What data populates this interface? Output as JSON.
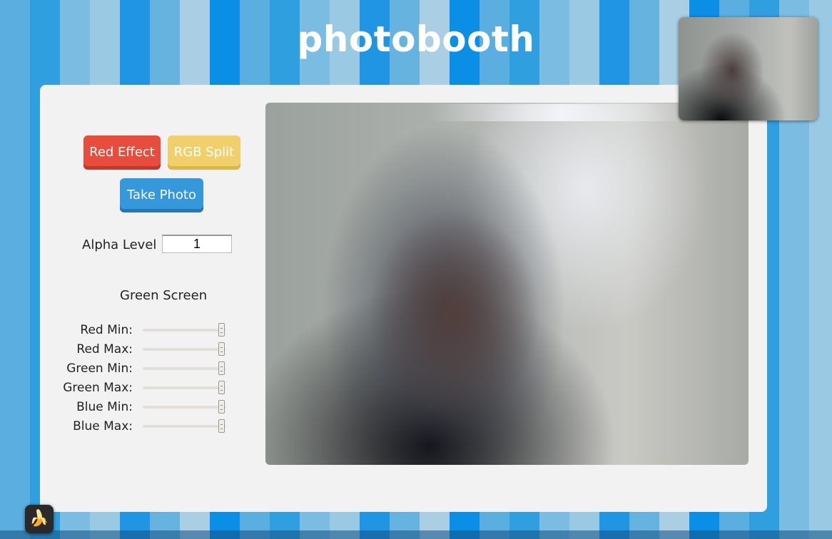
{
  "header": {
    "title": "photobooth"
  },
  "controls": {
    "red_effect_label": "Red Effect",
    "rgb_split_label": "RGB Split",
    "take_photo_label": "Take Photo",
    "alpha_label": "Alpha Level",
    "alpha_value": "1"
  },
  "green_screen": {
    "title": "Green Screen",
    "sliders": [
      {
        "label": "Red Min:",
        "value": 255
      },
      {
        "label": "Red Max:",
        "value": 255
      },
      {
        "label": "Green Min:",
        "value": 255
      },
      {
        "label": "Green Max:",
        "value": 255
      },
      {
        "label": "Blue Min:",
        "value": 255
      },
      {
        "label": "Blue Max:",
        "value": 255
      }
    ]
  },
  "dock": {
    "icon": "banana-icon",
    "glyph": "🍌"
  },
  "colors": {
    "red_button": "#e74c3c",
    "yellow_button": "#f1d06b",
    "blue_button": "#3498db",
    "panel_background": "#f3f2f2"
  }
}
